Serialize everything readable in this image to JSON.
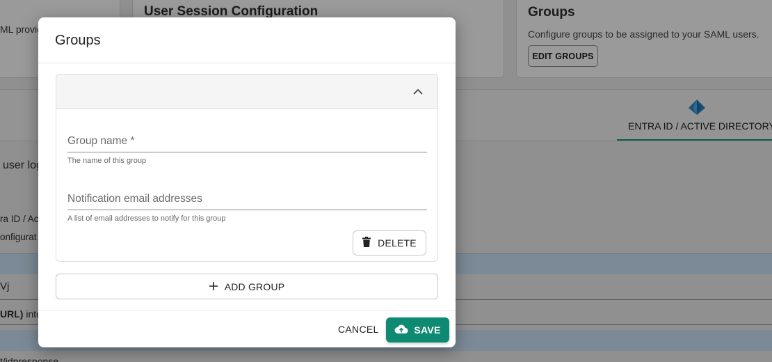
{
  "background": {
    "saml_fragment": "ML provide",
    "session_card_title": "User Session Configuration",
    "groups_card": {
      "title": "Groups",
      "description": "Configure groups to be assigned to your SAML users.",
      "button_label": "EDIT GROUPS"
    },
    "tab_label": "ENTRA ID / ACTIVE DIRECTORY",
    "fragments": {
      "user_login": "user log",
      "entra_frag": "ra ID / Ac",
      "config_frag": "onfigurat",
      "wj_frag": "Vj",
      "url_bold": "URL)",
      "url_into": " into",
      "idp_frag": "t/idpresponse"
    }
  },
  "modal": {
    "title": "Groups",
    "group_name": {
      "label": "Group name *",
      "value": "",
      "helper": "The name of this group"
    },
    "emails": {
      "label": "Notification email addresses",
      "value": "",
      "helper": "A list of email addresses to notify for this group"
    },
    "delete_label": "DELETE",
    "add_group_label": "ADD GROUP",
    "cancel_label": "CANCEL",
    "save_label": "SAVE"
  },
  "icons": [
    "chevron-up-icon",
    "trash-icon",
    "plus-icon",
    "cloud-upload-icon",
    "entra-id-logo-icon"
  ],
  "colors": {
    "accent": "#0e8a72",
    "overlay": "#8c8c8c"
  }
}
